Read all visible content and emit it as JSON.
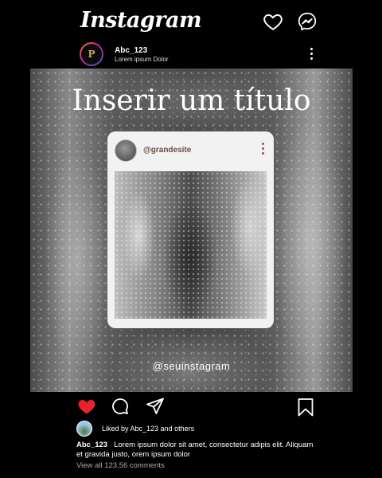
{
  "header": {
    "app_title": "Instagram"
  },
  "account": {
    "username": "Abc_123",
    "subtitle": "Lorem ipsum Dolor"
  },
  "post": {
    "title": "Inserir um título",
    "inner_card": {
      "handle": "@grandesite"
    },
    "instagram_handle": "@seuinstagram"
  },
  "actions": {
    "like_color": "#e8212d",
    "icons": [
      "heart-icon",
      "comment-icon",
      "send-icon",
      "bookmark-icon"
    ]
  },
  "likes": {
    "text": "Liked by Abc_123 and others"
  },
  "caption": {
    "username": "Abc_123",
    "text": "Lorem ipsum dolor sit amet, consectetur adipis elit. Aliquam et gravida justo, orem ipsum dolor"
  },
  "comments": {
    "view_all": "View all 123,56 comments"
  }
}
